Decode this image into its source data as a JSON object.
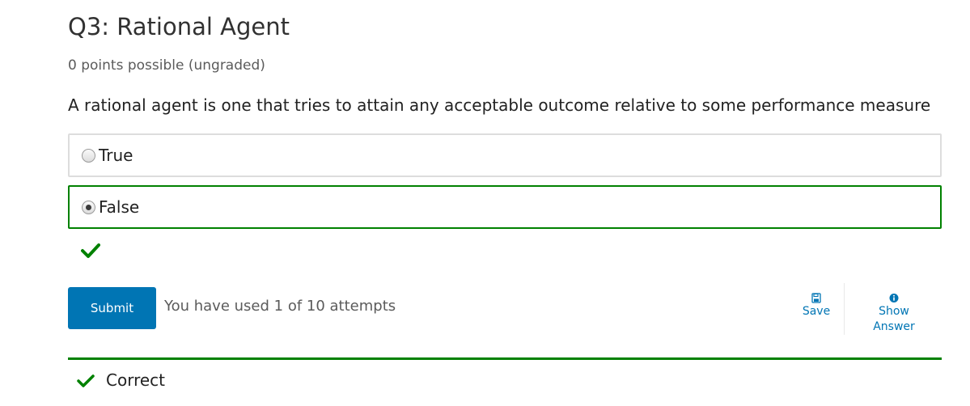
{
  "problem": {
    "title": "Q3: Rational Agent",
    "points": "0 points possible (ungraded)",
    "question": "A rational agent is one that tries to attain any acceptable outcome relative to some performance measure"
  },
  "choices": [
    {
      "label": "True",
      "selected": false
    },
    {
      "label": "False",
      "selected": true
    }
  ],
  "status_icon": "checkmark-icon",
  "actions": {
    "submit_label": "Submit",
    "attempts_text": "You have used 1 of 10 attempts",
    "save_label": "Save",
    "save_icon": "floppy-disk-icon",
    "show_answer_line1": "Show",
    "show_answer_line2": "Answer",
    "show_answer_icon": "info-circle-icon"
  },
  "result": {
    "label": "Correct",
    "icon": "checkmark-icon"
  },
  "colors": {
    "correct": "#008100",
    "accent": "#0075b4",
    "border": "#dddddd"
  }
}
